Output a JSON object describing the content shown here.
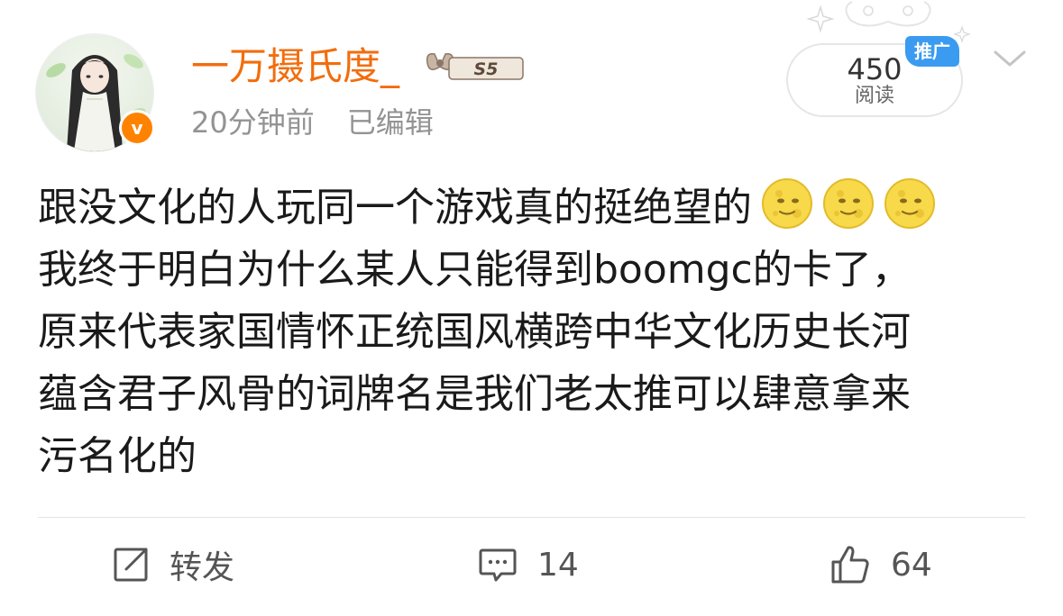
{
  "user": {
    "name": "一万摄氏度_",
    "rank_badge_text": "S5",
    "verified": true,
    "verified_mark": "v"
  },
  "post_meta": {
    "time": "20分钟前",
    "edited_label": "已编辑"
  },
  "stats": {
    "read_count": "450",
    "read_label": "阅读",
    "promo_label": "推广"
  },
  "post": {
    "lines": [
      "跟没文化的人玩同一个游戏真的挺绝望的",
      "我终于明白为什么某人只能得到boomgc的卡了，",
      "原来代表家国情怀正统国风横跨中华文化历史长河",
      "蕴含君子风骨的词牌名是我们老太推可以肆意拿来",
      "污名化的"
    ],
    "trailing_emojis": [
      "moon-face-emoji",
      "moon-face-emoji",
      "moon-face-emoji"
    ]
  },
  "actions": {
    "repost_label": "转发",
    "comment_count": "14",
    "like_count": "64"
  },
  "colors": {
    "username": "#f26d0d",
    "verified_badge": "#ff8200",
    "promo_badge": "#3a9bf0",
    "meta_text": "#939393"
  }
}
